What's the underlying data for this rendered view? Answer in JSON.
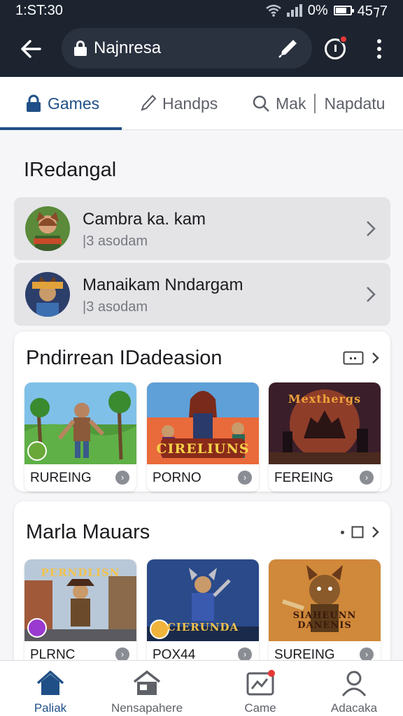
{
  "status_bar": {
    "time": "1:ST:30",
    "battery": "0%",
    "extra": "45⁊7"
  },
  "app_bar": {
    "url": "Najnresa"
  },
  "tabs": [
    {
      "label": "Games"
    },
    {
      "label": "Handps"
    },
    {
      "label": "Mak"
    },
    {
      "label": "Napdatu"
    }
  ],
  "section": {
    "title": "IRedangal"
  },
  "list": [
    {
      "title": "Cambra ka. kam",
      "subtitle": "|3 asodam"
    },
    {
      "title": "Manaikam Nndargam",
      "subtitle": "|3 asodam"
    }
  ],
  "card1": {
    "title": "Pndirrean IDadeasion",
    "tiles": [
      {
        "label": "RUREING",
        "art_text": ""
      },
      {
        "label": "PORNO",
        "art_text": "CIRELIUNS"
      },
      {
        "label": "FEREING",
        "art_text": "Mexthergs"
      }
    ]
  },
  "card2": {
    "title": "Marla Mauars",
    "tiles": [
      {
        "label": "PLRNC",
        "art_text": "PERNDLISN"
      },
      {
        "label": "POX44",
        "art_text": "CIERUNDA"
      },
      {
        "label": "SUREING",
        "art_text": "SIAHEUNN DANENIS"
      }
    ]
  },
  "bottom_nav": [
    {
      "label": "Paliak",
      "icon": "home-icon"
    },
    {
      "label": "Nensapahere",
      "icon": "store-icon"
    },
    {
      "label": "Came",
      "icon": "game-icon"
    },
    {
      "label": "Adacaka",
      "icon": "person-icon"
    }
  ],
  "colors": {
    "accent": "#1f4f86",
    "topbar": "#1d2430",
    "badge": "#e53935"
  }
}
